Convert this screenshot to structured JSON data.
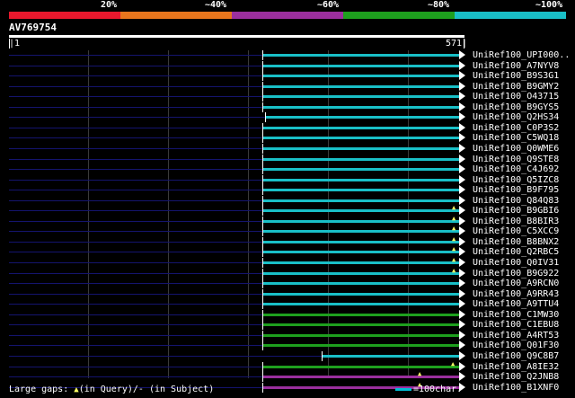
{
  "legend": {
    "labels": [
      "20%",
      "~40%",
      "~60%",
      "~80%",
      "~100%"
    ],
    "colors": [
      "#e8182d",
      "#e8761d",
      "#9b2f9e",
      "#1ea01e",
      "#19bfc7"
    ]
  },
  "query": {
    "name": "AV769754",
    "start": "|1",
    "end": "571|"
  },
  "hits": [
    {
      "name": "UniRef100_UPI000..",
      "color": "#19bfc7"
    },
    {
      "name": "UniRef100_A7NYV8",
      "color": "#19bfc7"
    },
    {
      "name": "UniRef100_B9S3G1",
      "color": "#19bfc7"
    },
    {
      "name": "UniRef100_B9GMY2",
      "color": "#19bfc7"
    },
    {
      "name": "UniRef100_O43715",
      "color": "#19bfc7"
    },
    {
      "name": "UniRef100_B9GYS5",
      "color": "#19bfc7"
    },
    {
      "name": "UniRef100_Q2HS34",
      "color": "#19bfc7"
    },
    {
      "name": "UniRef100_C0P3S2",
      "color": "#19bfc7"
    },
    {
      "name": "UniRef100_C5WQ18",
      "color": "#19bfc7"
    },
    {
      "name": "UniRef100_Q0WME6",
      "color": "#19bfc7"
    },
    {
      "name": "UniRef100_Q9STE8",
      "color": "#19bfc7"
    },
    {
      "name": "UniRef100_C4J692",
      "color": "#19bfc7"
    },
    {
      "name": "UniRef100_Q5IZC8",
      "color": "#19bfc7"
    },
    {
      "name": "UniRef100_B9F795",
      "color": "#19bfc7"
    },
    {
      "name": "UniRef100_Q84Q83",
      "color": "#19bfc7"
    },
    {
      "name": "UniRef100_B9GBI6",
      "color": "#19bfc7"
    },
    {
      "name": "UniRef100_B8BIR3",
      "color": "#19bfc7"
    },
    {
      "name": "UniRef100_C5XCC9",
      "color": "#19bfc7"
    },
    {
      "name": "UniRef100_B8BNX2",
      "color": "#19bfc7"
    },
    {
      "name": "UniRef100_Q2RBC5",
      "color": "#19bfc7"
    },
    {
      "name": "UniRef100_Q0IV31",
      "color": "#19bfc7"
    },
    {
      "name": "UniRef100_B9G922",
      "color": "#19bfc7"
    },
    {
      "name": "UniRef100_A9RCN0",
      "color": "#19bfc7"
    },
    {
      "name": "UniRef100_A9RR43",
      "color": "#19bfc7"
    },
    {
      "name": "UniRef100_A9TTU4",
      "color": "#19bfc7"
    },
    {
      "name": "UniRef100_C1MW30",
      "color": "#1ea01e"
    },
    {
      "name": "UniRef100_C1EBU8",
      "color": "#1ea01e"
    },
    {
      "name": "UniRef100_A4RT53",
      "color": "#1ea01e"
    },
    {
      "name": "UniRef100_Q01F30",
      "color": "#1ea01e"
    },
    {
      "name": "UniRef100_Q9C8B7",
      "color": "#19bfc7"
    },
    {
      "name": "UniRef100_A8IE32",
      "color": "#1ea01e"
    },
    {
      "name": "UniRef100_Q2JNB8",
      "color": "#9b2f9e"
    },
    {
      "name": "UniRef100_B1XNF0",
      "color": "#9b2f9e"
    }
  ],
  "footer": {
    "gaps_label": "Large gaps:",
    "query_text": "(in Query)/",
    "subject_text": "- (in Subject)",
    "scale_text": "=100char."
  }
}
